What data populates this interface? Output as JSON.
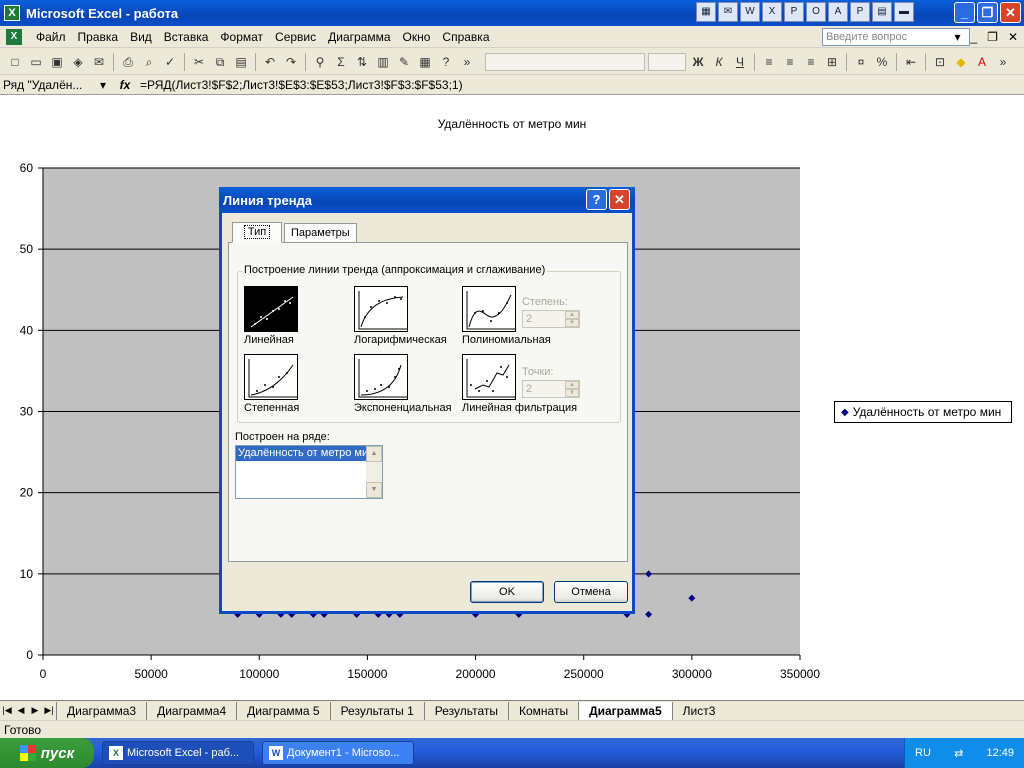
{
  "window": {
    "title": "Microsoft Excel - работа",
    "app_icon": "X"
  },
  "menu": {
    "items": [
      "Файл",
      "Правка",
      "Вид",
      "Вставка",
      "Формат",
      "Сервис",
      "Диаграмма",
      "Окно",
      "Справка"
    ],
    "help_placeholder": "Введите вопрос"
  },
  "formula_bar": {
    "name_box": "Ряд \"Удалён...",
    "fx": "fx",
    "formula": "=РЯД(Лист3!$F$2;Лист3!$E$3:$E$53;Лист3!$F$3:$F$53;1)"
  },
  "chart_data": {
    "type": "scatter",
    "title": "Удалённость от метро мин",
    "xlim": [
      0,
      350000
    ],
    "ylim": [
      0,
      60
    ],
    "x_ticks": [
      0,
      50000,
      100000,
      150000,
      200000,
      250000,
      300000,
      350000
    ],
    "y_ticks": [
      0,
      10,
      20,
      30,
      40,
      50,
      60
    ],
    "grid": true,
    "plot_background": "#c0c0c0",
    "series": [
      {
        "name": "Удалённость от метро мин",
        "color": "#000080",
        "points": [
          [
            90000,
            5
          ],
          [
            100000,
            5
          ],
          [
            110000,
            5
          ],
          [
            115000,
            5
          ],
          [
            125000,
            5
          ],
          [
            130000,
            5
          ],
          [
            145000,
            5
          ],
          [
            155000,
            5
          ],
          [
            160000,
            5
          ],
          [
            165000,
            5
          ],
          [
            200000,
            5
          ],
          [
            220000,
            5
          ],
          [
            270000,
            5
          ],
          [
            280000,
            5
          ],
          [
            280000,
            10
          ],
          [
            300000,
            7
          ]
        ]
      }
    ],
    "legend": "right"
  },
  "legend_label": "Удалённость от метро мин",
  "dialog": {
    "title": "Линия тренда",
    "tabs": [
      "Тип",
      "Параметры"
    ],
    "group_label": "Построение линии тренда (аппроксимация и сглаживание)",
    "types": [
      "Линейная",
      "Логарифмическая",
      "Полиномиальная",
      "Степенная",
      "Экспоненциальная",
      "Линейная фильтрация"
    ],
    "degree_label": "Степень:",
    "degree_value": "2",
    "points_label": "Точки:",
    "points_value": "2",
    "series_label": "Построен на ряде:",
    "series_item": "Удалённость от метро мин",
    "ok": "OK",
    "cancel": "Отмена"
  },
  "sheet_tabs": [
    "Диаграмма3",
    "Диаграмма4",
    "Диаграмма 5",
    "Результаты 1",
    "Результаты",
    "Комнаты",
    "Диаграмма5",
    "Лист3"
  ],
  "active_tab": "Диаграмма5",
  "status": "Готово",
  "taskbar": {
    "start": "пуск",
    "tasks": [
      "Microsoft Excel - раб...",
      "Документ1 - Microso..."
    ],
    "lang": "RU",
    "time": "12:49"
  }
}
